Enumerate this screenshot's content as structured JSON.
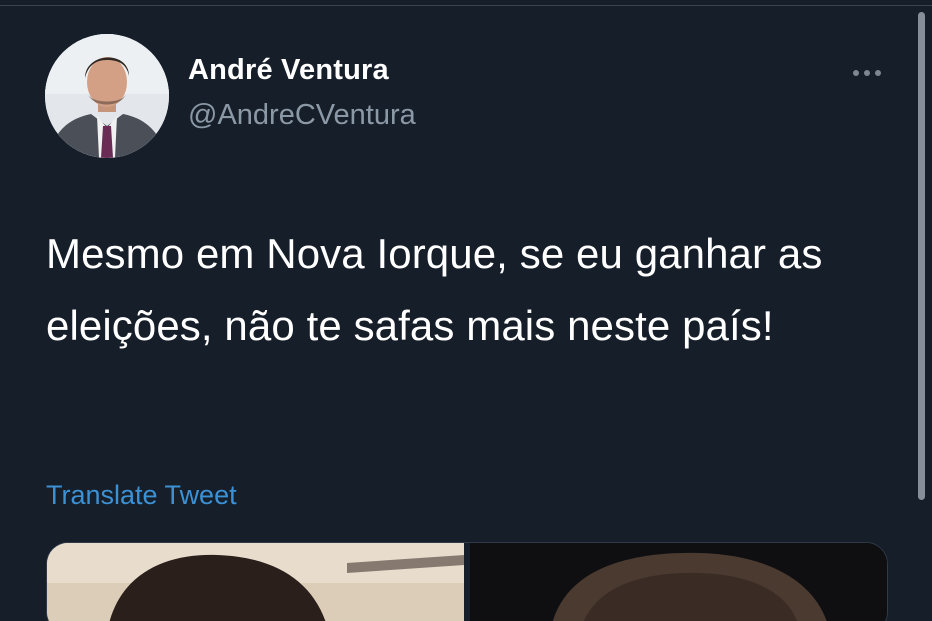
{
  "tweet": {
    "author_name": "André Ventura",
    "author_handle": "@AndreCVentura",
    "text": "Mesmo em Nova Iorque, se eu ganhar as eleições, não te safas mais neste país!",
    "translate_label": "Translate Tweet"
  },
  "icons": {
    "more": "more-horizontal-icon"
  },
  "colors": {
    "background": "#161e29",
    "name_text": "#ffffff",
    "handle_text": "#8b98a5",
    "link": "#3c91d4"
  }
}
